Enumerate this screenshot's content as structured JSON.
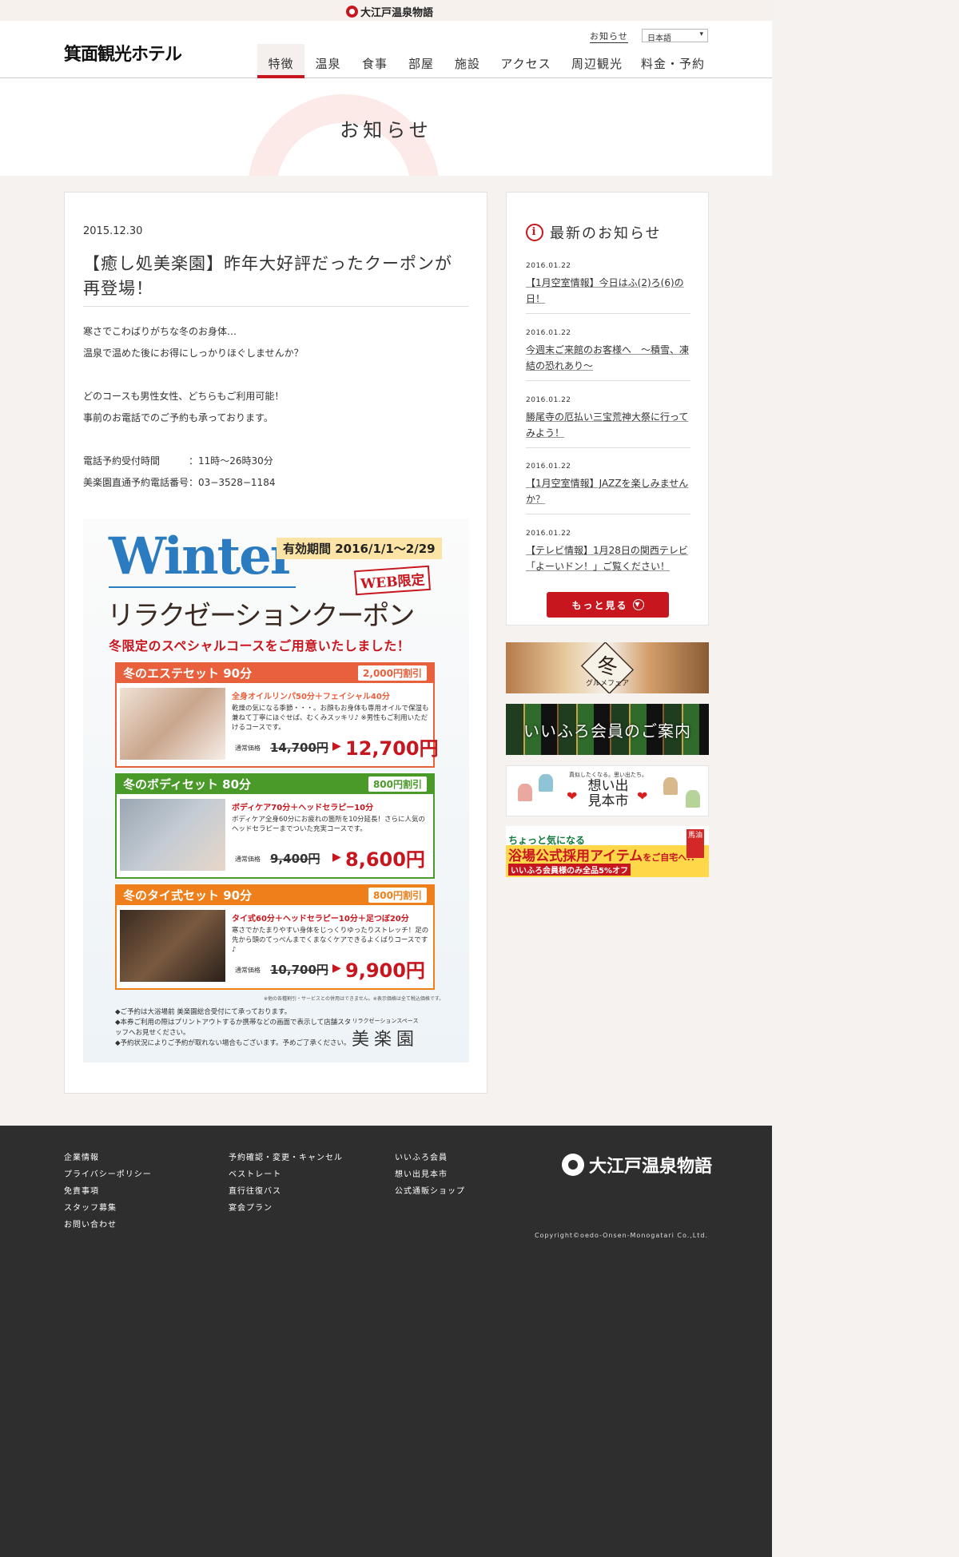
{
  "brand": {
    "name": "大江戸温泉物語"
  },
  "header": {
    "logo": "箕面観光ホテル",
    "notice_link": "お知らせ",
    "language": "日本語",
    "nav": [
      {
        "label": "特徴",
        "active": true
      },
      {
        "label": "温泉"
      },
      {
        "label": "食事"
      },
      {
        "label": "部屋"
      },
      {
        "label": "施設"
      },
      {
        "label": "アクセス"
      },
      {
        "label": "周辺観光"
      },
      {
        "label": "料金・予約"
      }
    ]
  },
  "hero": {
    "title": "お知らせ"
  },
  "post": {
    "date": "2015.12.30",
    "title": "【癒し処美楽園】昨年大好評だったクーポンが再登場！",
    "body": [
      "寒さでこわばりがちな冬のお身体…",
      "温泉で温めた後にお得にしっかりほぐしませんか？",
      "",
      "どのコースも男性女性、どちらもご利用可能！",
      "事前のお電話でのご予約も承っております。",
      "",
      "電話予約受付時間　　　：11時〜26時30分",
      "美楽園直通予約電話番号：03−3528−1184"
    ]
  },
  "coupon": {
    "winter": "Winter",
    "period": "有効期間 2016/1/1～2/29",
    "web_only": "WEB限定",
    "title": "リラクゼーションクーポン",
    "subtitle": "冬限定のスペシャルコースをご用意いたしました！",
    "regular_label": "通常価格",
    "courses": [
      {
        "name": "冬のエステセット 90分",
        "discount": "2,000円割引",
        "color": "#e8603c",
        "line": "全身オイルリンパ50分＋フェイシャル40分",
        "desc": "乾燥の気になる季節・・・。お顔もお身体も専用オイルで保湿も兼ねて丁寧にほぐせば、むくみスッキリ♪ ※男性もご利用いただけるコースです。",
        "old_price": "14,700円",
        "new_price": "12,700円"
      },
      {
        "name": "冬のボディセット 80分",
        "discount": "800円割引",
        "color": "#4a9a2a",
        "line": "ボディケア70分＋ヘッドセラピー10分",
        "desc": "ボディケア全身60分にお疲れの箇所を10分延長！さらに人気のヘッドセラピーまでついた充実コースです。",
        "old_price": "9,400円",
        "new_price": "8,600円"
      },
      {
        "name": "冬のタイ式セット 90分",
        "discount": "800円割引",
        "color": "#ee7f1a",
        "line": "タイ式60分＋ヘッドセラピー10分＋足つぼ20分",
        "desc": "寒さでかたまりやすい身体をじっくりゆったりストレッチ！足の先から頭のてっぺんまでくまなくケアできるよくばりコースです♪",
        "old_price": "10,700円",
        "new_price": "9,900円"
      }
    ],
    "fine_print": "※他の各種割引・サービスとの併用はできません。※表示価格は全て税込価格です。",
    "notes": [
      "◆ご予約は大浴場前 美楽園総合受付にて承っております。",
      "◆本券ご利用の際はプリントアウトするか携帯などの画面で表示して店舗スタッフへお見せください。",
      "◆予約状況によりご予約が取れない場合もございます。予めご了承ください。"
    ],
    "shop_small": "リラクゼーションスペース",
    "shop_name": "美楽園"
  },
  "sidebar": {
    "title": "最新のお知らせ",
    "news": [
      {
        "date": "2016.01.22",
        "title": "【1月空室情報】今日はふ(2)ろ(6)の日！"
      },
      {
        "date": "2016.01.22",
        "title": "今週末ご来館のお客様へ　〜積雪、凍結の恐れあり〜"
      },
      {
        "date": "2016.01.22",
        "title": "勝尾寺の厄払い三宝荒神大祭に行ってみよう！"
      },
      {
        "date": "2016.01.22",
        "title": "【1月空室情報】JAZZを楽しみませんか？"
      },
      {
        "date": "2016.01.22",
        "title": "【テレビ情報】1月28日の関西テレビ「よーいドン！」ご覧ください！"
      }
    ],
    "more_label": "もっと見る"
  },
  "banners": {
    "gourmet": {
      "main": "冬",
      "sub": "グルメフェア"
    },
    "member": "いいふろ会員のご案内",
    "memory": {
      "small": "真似したくなる。思い出たち。",
      "main": "想い出 見本市"
    },
    "goods": {
      "line1": "ちょっと気になる",
      "line2a": "浴場公式採用アイテム",
      "line2b": "をご自宅へ!!",
      "line3": "いいふろ会員様のみ全品5%オフ",
      "tag": "馬油"
    }
  },
  "footer": {
    "col1": [
      "企業情報",
      "プライバシーポリシー",
      "免責事項",
      "スタッフ募集",
      "お問い合わせ"
    ],
    "col2": [
      "予約確認・変更・キャンセル",
      "ベストレート",
      "直行往復バス",
      "宴会プラン"
    ],
    "col3": [
      "いいふろ会員",
      "想い出見本市",
      "公式通販ショップ"
    ],
    "brand": "大江戸温泉物語",
    "copyright": "Copyright©oedo-Onsen-Monogatari Co.,Ltd."
  },
  "colors": {
    "accent": "#c8161e"
  }
}
